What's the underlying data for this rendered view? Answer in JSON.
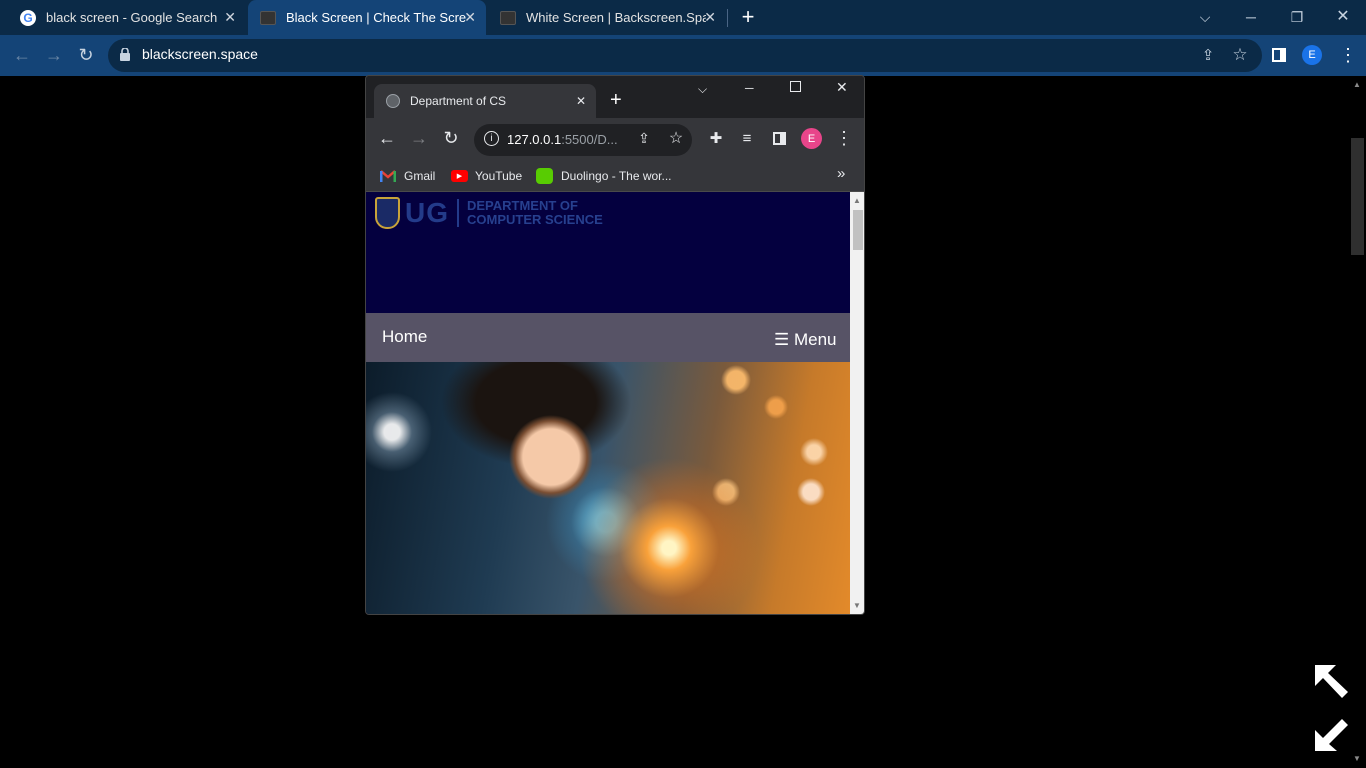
{
  "outer_browser": {
    "tabs": [
      {
        "title": "black screen - Google Search",
        "active": false
      },
      {
        "title": "Black Screen | Check The Screen",
        "active": true
      },
      {
        "title": "White Screen | Backscreen.Space",
        "active": false
      }
    ],
    "new_tab_label": "+",
    "url": "blackscreen.space",
    "profile_initial": "E"
  },
  "inner_browser": {
    "tab_title": "Department of CS",
    "new_tab_label": "+",
    "url_host": "127.0.0.1",
    "url_rest": ":5500/D...",
    "profile_initial": "E",
    "bookmarks": [
      {
        "label": "Gmail",
        "icon": "gmail-icon"
      },
      {
        "label": "YouTube",
        "icon": "youtube-icon"
      },
      {
        "label": "Duolingo - The wor...",
        "icon": "duolingo-icon"
      }
    ],
    "overflow_label": "»"
  },
  "site": {
    "logo_abbr": "UG",
    "dept_line1": "DEPARTMENT OF",
    "dept_line2": "COMPUTER SCIENCE",
    "nav_home": "Home",
    "nav_menu": "☰ Menu"
  },
  "colors": {
    "outer_tabstrip": "#0b2a47",
    "outer_toolbar": "#144477",
    "site_header": "#04003f",
    "site_nav": "#575366",
    "profile_avatar": "#e8458a"
  }
}
